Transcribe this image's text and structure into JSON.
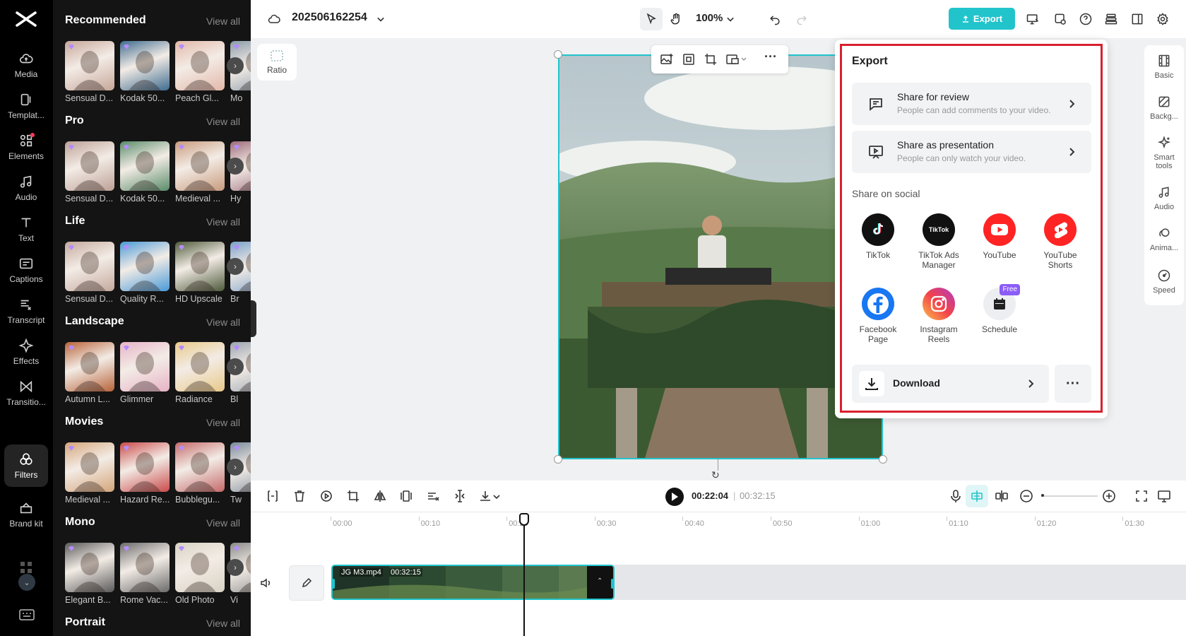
{
  "app": {
    "project_name": "202506162254",
    "zoom": "100%",
    "export_label": "Export"
  },
  "rail": [
    {
      "label": "Media"
    },
    {
      "label": "Templat..."
    },
    {
      "label": "Elements"
    },
    {
      "label": "Audio"
    },
    {
      "label": "Text"
    },
    {
      "label": "Captions"
    },
    {
      "label": "Transcript"
    },
    {
      "label": "Effects"
    },
    {
      "label": "Transitio..."
    },
    {
      "label": "Filters"
    },
    {
      "label": "Brand kit"
    }
  ],
  "filters": {
    "view_all": "View all",
    "sections": [
      {
        "title": "Recommended",
        "items": [
          "Sensual D...",
          "Kodak 50...",
          "Peach Gl...",
          "Mo"
        ]
      },
      {
        "title": "Pro",
        "items": [
          "Sensual D...",
          "Kodak 50...",
          "Medieval ...",
          "Hy"
        ]
      },
      {
        "title": "Life",
        "items": [
          "Sensual D...",
          "Quality R...",
          "HD Upscale",
          "Br"
        ]
      },
      {
        "title": "Landscape",
        "items": [
          "Autumn L...",
          "Glimmer",
          "Radiance",
          "Bl"
        ]
      },
      {
        "title": "Movies",
        "items": [
          "Medieval ...",
          "Hazard Re...",
          "Bubblegu...",
          "Tw"
        ]
      },
      {
        "title": "Mono",
        "items": [
          "Elegant B...",
          "Rome Vac...",
          "Old Photo",
          "Vi"
        ]
      },
      {
        "title": "Portrait",
        "items": []
      }
    ]
  },
  "canvas": {
    "ratio_label": "Ratio"
  },
  "right_rail": [
    {
      "label": "Basic"
    },
    {
      "label": "Backg..."
    },
    {
      "label": "Smart tools"
    },
    {
      "label": "Audio"
    },
    {
      "label": "Anima..."
    },
    {
      "label": "Speed"
    }
  ],
  "export_panel": {
    "title": "Export",
    "review": {
      "title": "Share for review",
      "subtitle": "People can add comments to your video."
    },
    "presentation": {
      "title": "Share as presentation",
      "subtitle": "People can only watch your video."
    },
    "social_title": "Share on social",
    "social": [
      {
        "label": "TikTok"
      },
      {
        "label": "TikTok Ads Manager",
        "logo_text": "TikTok"
      },
      {
        "label": "YouTube"
      },
      {
        "label": "YouTube Shorts"
      },
      {
        "label": "Facebook Page"
      },
      {
        "label": "Instagram Reels"
      },
      {
        "label": "Schedule",
        "badge": "Free"
      }
    ],
    "download_label": "Download"
  },
  "timeline": {
    "current_time": "00:22:04",
    "separator": "|",
    "total_time": "00:32:15",
    "ruler": [
      "00:00",
      "00:10",
      "00:20",
      "00:30",
      "00:40",
      "00:50",
      "01:00",
      "01:10",
      "01:20",
      "01:30"
    ],
    "clip_name": "JG M3.mp4",
    "clip_duration": "00:32:15"
  },
  "colors": {
    "accent": "#22c4cc",
    "highlight_frame": "#d9202e"
  }
}
